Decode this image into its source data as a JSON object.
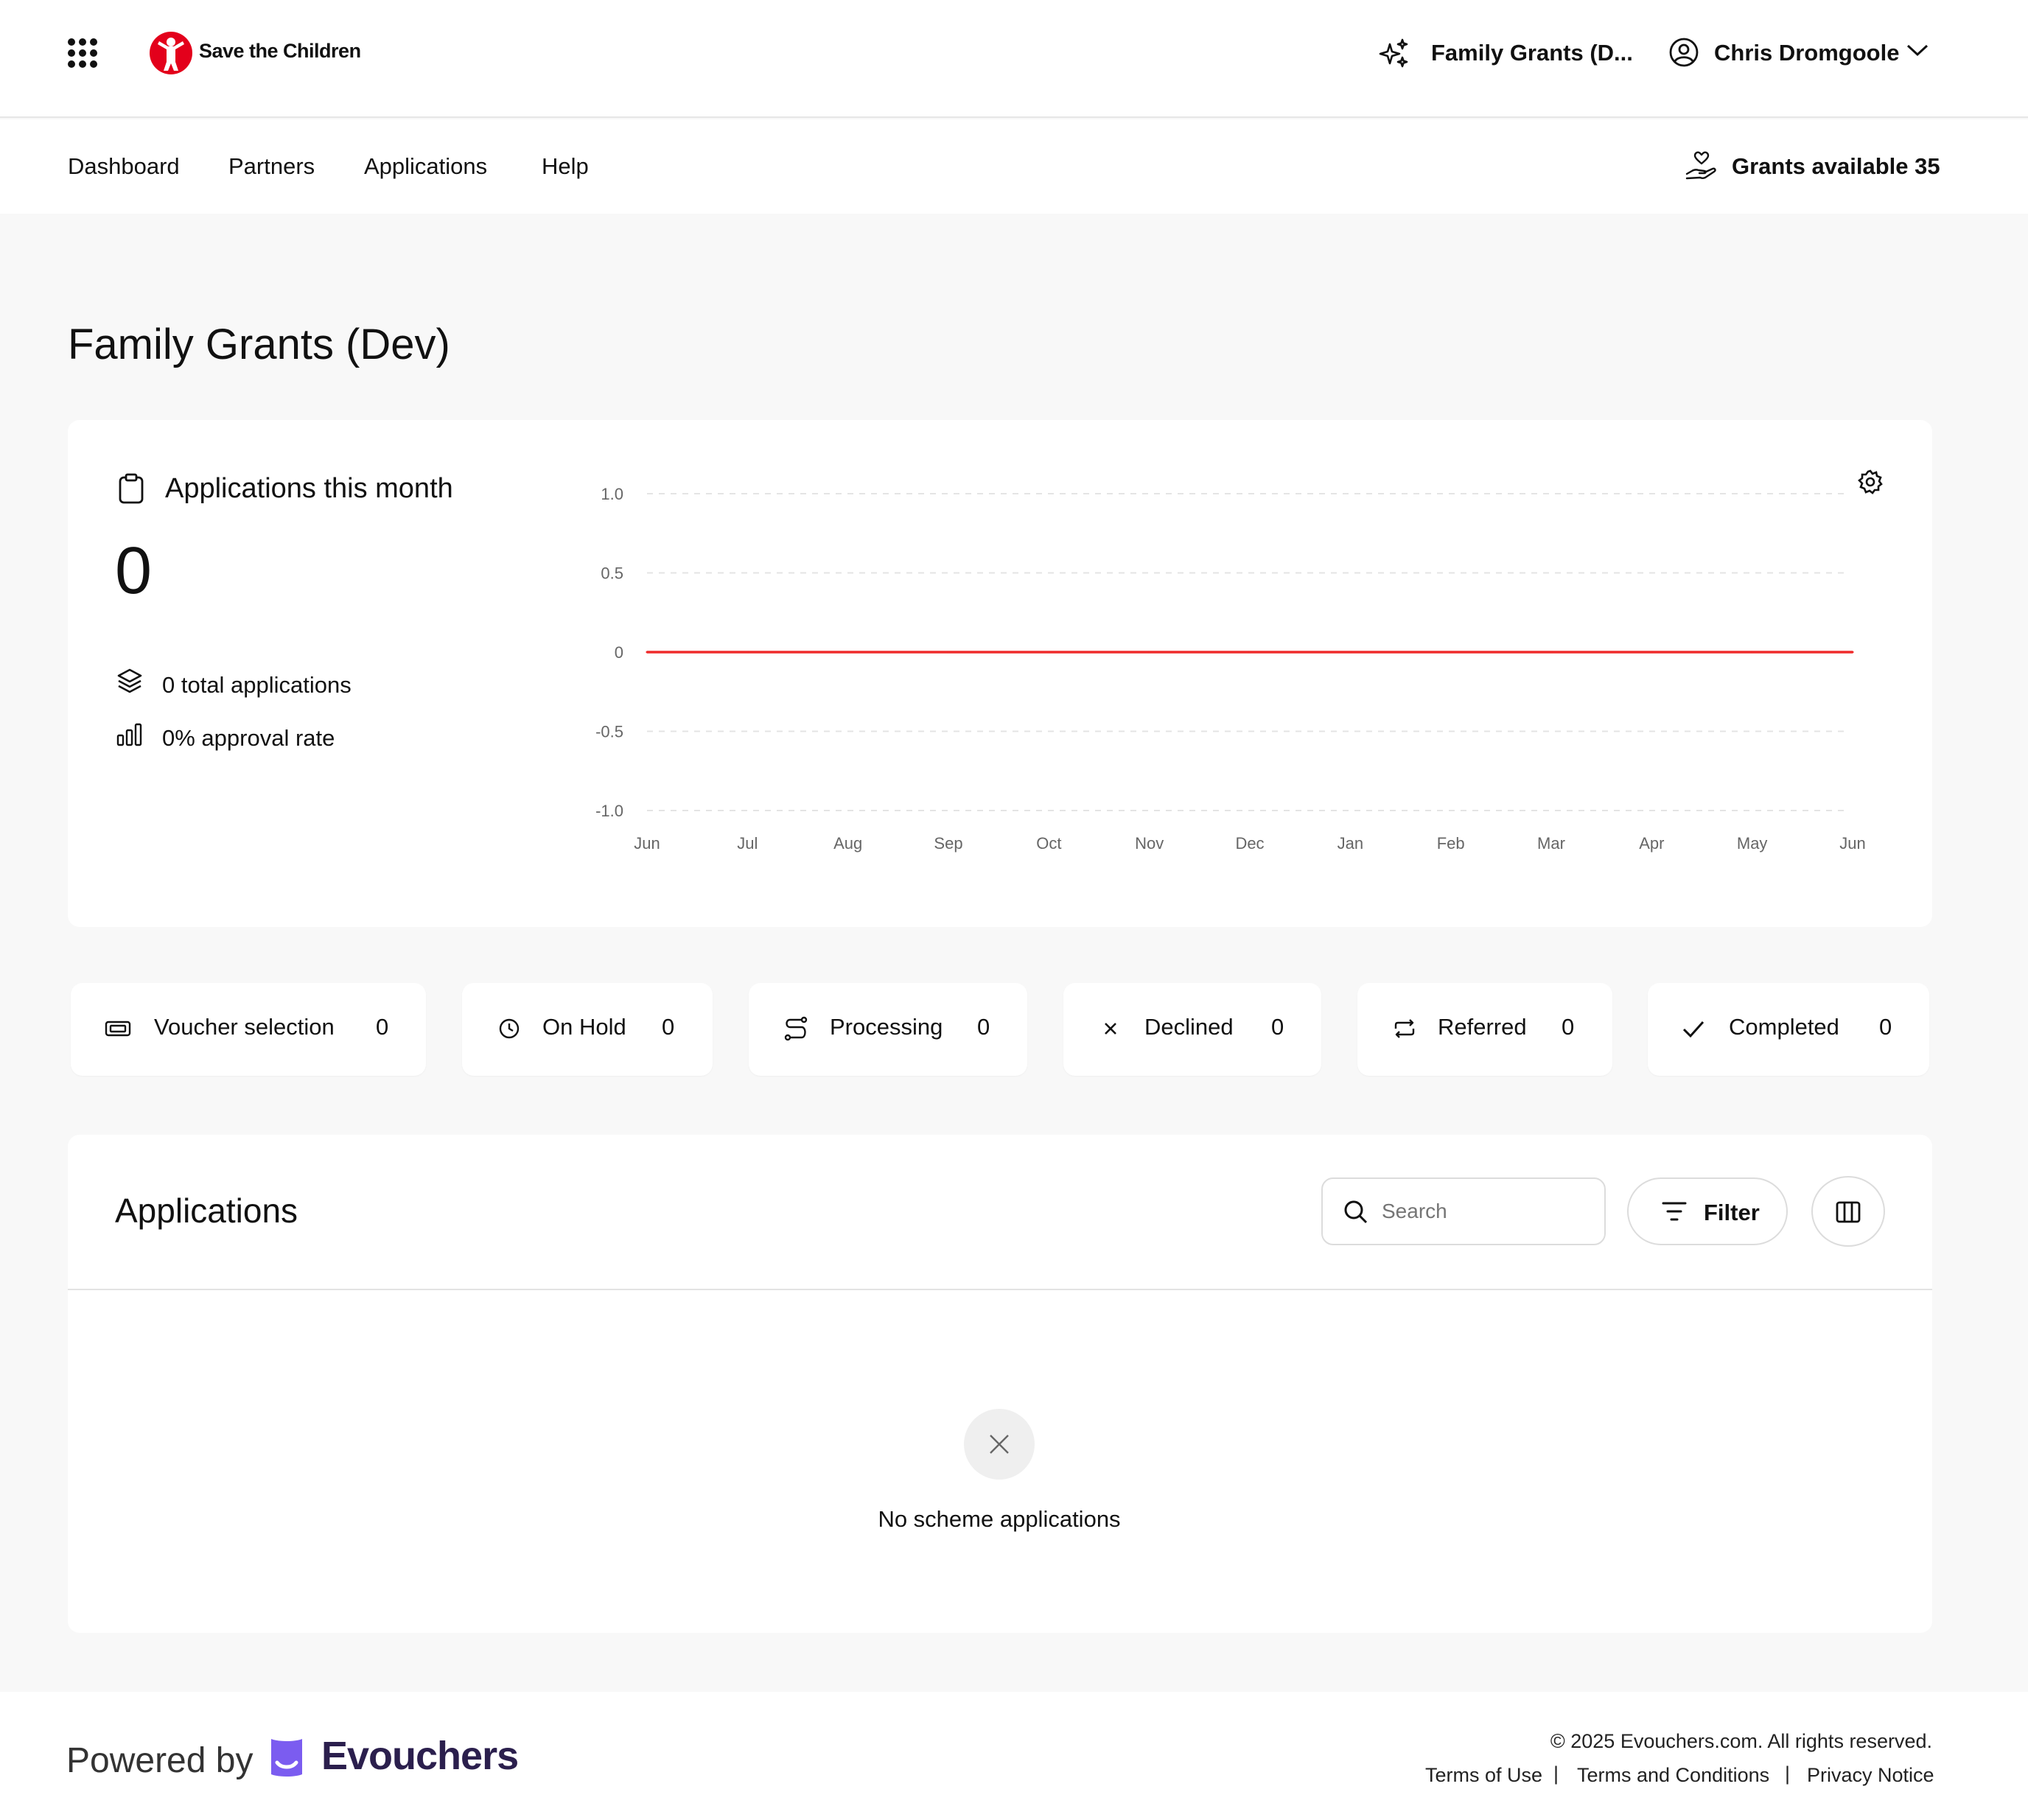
{
  "header": {
    "brand_name": "Save the Children",
    "scheme_switch": "Family Grants (D...",
    "user_name": "Chris Dromgoole"
  },
  "nav": {
    "items": [
      {
        "label": "Dashboard"
      },
      {
        "label": "Partners"
      },
      {
        "label": "Applications"
      },
      {
        "label": "Help"
      }
    ],
    "grants_label": "Grants available 35"
  },
  "page": {
    "title": "Family Grants (Dev)"
  },
  "summary": {
    "heading": "Applications this month",
    "count": "0",
    "total_text": "0 total applications",
    "approval_text": "0% approval rate"
  },
  "chart_data": {
    "type": "line",
    "x": [
      "Jun",
      "Jul",
      "Aug",
      "Sep",
      "Oct",
      "Nov",
      "Dec",
      "Jan",
      "Feb",
      "Mar",
      "Apr",
      "May",
      "Jun"
    ],
    "series": [
      {
        "values": [
          0,
          0,
          0,
          0,
          0,
          0,
          0,
          0,
          0,
          0,
          0,
          0,
          0
        ],
        "color": "#ef2b2b"
      }
    ],
    "yticks": [
      "1.0",
      "0.5",
      "0",
      "-0.5",
      "-1.0"
    ],
    "ylim": [
      -1.0,
      1.0
    ],
    "grid": "horizontal dashed",
    "title": "",
    "xlabel": "",
    "ylabel": ""
  },
  "statuses": [
    {
      "label": "Voucher selection",
      "count": "0",
      "icon": "ticket-icon"
    },
    {
      "label": "On Hold",
      "count": "0",
      "icon": "clock-icon"
    },
    {
      "label": "Processing",
      "count": "0",
      "icon": "route-icon"
    },
    {
      "label": "Declined",
      "count": "0",
      "icon": "x-icon"
    },
    {
      "label": "Referred",
      "count": "0",
      "icon": "repeat-icon"
    },
    {
      "label": "Completed",
      "count": "0",
      "icon": "check-icon"
    }
  ],
  "applications": {
    "heading": "Applications",
    "search_placeholder": "Search",
    "filter_label": "Filter",
    "empty_text": "No scheme applications"
  },
  "footer": {
    "powered_by": "Powered by",
    "brand": "Evouchers",
    "copyright": "© 2025 Evouchers.com. All rights reserved.",
    "links": [
      {
        "label": "Terms of Use"
      },
      {
        "label": "Terms and Conditions"
      },
      {
        "label": "Privacy Notice"
      }
    ],
    "separator": "|"
  },
  "colors": {
    "brand_red": "#e3001b",
    "chart_line": "#ef2b2b",
    "evouchers_purple": "#7b5cf0",
    "evouchers_text": "#2b1f4d"
  }
}
